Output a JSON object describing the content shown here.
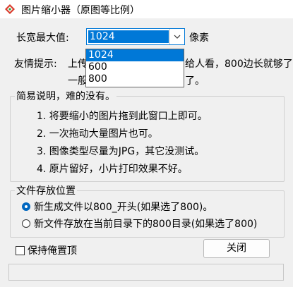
{
  "window": {
    "title": "图片缩小器（原图等比例）",
    "app_icon": "app-logo-icon"
  },
  "max_size": {
    "label": "长宽最大值:",
    "value": "1024",
    "unit": "像素",
    "options": [
      "1024",
      "600",
      "800"
    ]
  },
  "tip": {
    "label": "友情提示:",
    "line1_a": "上传",
    "line1_b": "给人看，800边长就够了",
    "line2_a": "一般",
    "line2_b": "了。"
  },
  "description": {
    "legend": "简易说明，难的没有。",
    "steps": [
      "1. 将要缩小的图片拖到此窗口上即可。",
      "2. 一次拖动大量图片也可。",
      "3. 图像类型尽量为JPG，其它没测试。",
      "4. 原片留好，小片打印效果不好。"
    ]
  },
  "storage": {
    "legend": "文件存放位置",
    "options": [
      "新生成文件以800_开头(如果选了800)。",
      "新文件存放在当前目录下的800目录(如果选了800)"
    ],
    "selected_index": 0
  },
  "topmost": {
    "label": "保持俺置顶",
    "checked": false
  },
  "close_button": {
    "label": "关闭"
  },
  "status": {
    "text": ""
  }
}
